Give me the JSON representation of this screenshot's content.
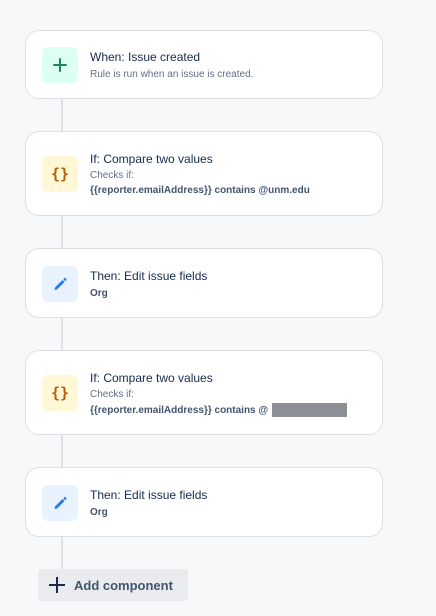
{
  "rule": {
    "components": [
      {
        "kind": "trigger",
        "icon": "plus-icon",
        "title": "When: Issue created",
        "subtitle": "Rule is run when an issue is created."
      },
      {
        "kind": "condition",
        "icon": "braces-icon",
        "title": "If: Compare two values",
        "subtitle": "Checks if:",
        "detail": "{{reporter.emailAddress}} contains @unm.edu"
      },
      {
        "kind": "action",
        "icon": "pencil-icon",
        "title": "Then: Edit issue fields",
        "detail": "Org"
      },
      {
        "kind": "condition",
        "icon": "braces-icon",
        "title": "If: Compare two values",
        "subtitle": "Checks if:",
        "detail": "{{reporter.emailAddress}} contains @",
        "redacted": true
      },
      {
        "kind": "action",
        "icon": "pencil-icon",
        "title": "Then: Edit issue fields",
        "detail": "Org"
      }
    ],
    "add_component_label": "Add component"
  },
  "colors": {
    "background": "#f7f8f9",
    "trigger_icon": "#1f845a",
    "condition_icon": "#b65c02",
    "action_icon": "#1d7afc",
    "connector": "#dfe1e6"
  }
}
